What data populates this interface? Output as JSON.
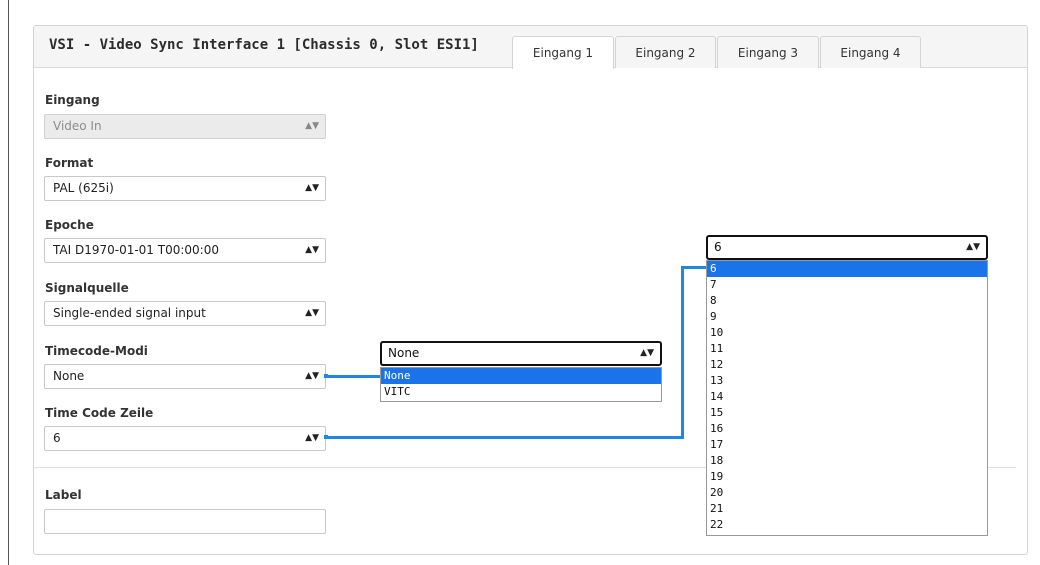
{
  "panel": {
    "title": "VSI - Video Sync Interface 1 [Chassis 0, Slot ESI1]"
  },
  "tabs": [
    "Eingang 1",
    "Eingang 2",
    "Eingang 3",
    "Eingang 4"
  ],
  "active_tab": "Eingang 1",
  "fields": {
    "eingang": {
      "label": "Eingang",
      "value": "Video In",
      "disabled": true
    },
    "format": {
      "label": "Format",
      "value": "PAL (625i)"
    },
    "epoche": {
      "label": "Epoche",
      "value": "TAI D1970-01-01 T00:00:00"
    },
    "signalquelle": {
      "label": "Signalquelle",
      "value": "Single-ended signal input"
    },
    "timecode_modi": {
      "label": "Timecode-Modi",
      "value": "None"
    },
    "time_code_zeile": {
      "label": "Time Code Zeile",
      "value": "6"
    },
    "label": {
      "label": "Label",
      "value": ""
    }
  },
  "timecode_popup": {
    "value": "None",
    "options": [
      "None",
      "VITC"
    ],
    "selected": "None"
  },
  "zeile_popup": {
    "value": "6",
    "options": [
      "6",
      "7",
      "8",
      "9",
      "10",
      "11",
      "12",
      "13",
      "14",
      "15",
      "16",
      "17",
      "18",
      "19",
      "20",
      "21",
      "22"
    ],
    "selected": "6"
  },
  "colors": {
    "connector": "#2286e3",
    "highlight": "#1a73e8"
  },
  "icons": {
    "select_arrow": "up-down-chevron-icon"
  }
}
